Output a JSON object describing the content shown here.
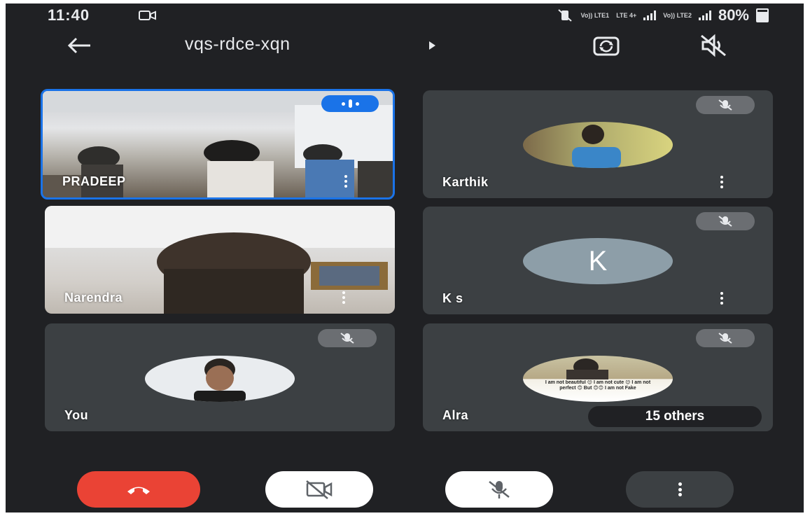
{
  "status_bar": {
    "time": "11:40",
    "net1": "Vo)) LTE1",
    "net2": "LTE 4+",
    "net3": "Vo)) LTE2",
    "battery": "80%"
  },
  "toolbar": {
    "meeting_code": "vqs-rdce-xqn"
  },
  "participants": [
    {
      "name": "PRADEEP",
      "state": "speaking"
    },
    {
      "name": "Karthik",
      "muted": true
    },
    {
      "name": "Narendra"
    },
    {
      "name": "K s",
      "initial": "K",
      "muted": true
    },
    {
      "name": "You",
      "muted": true
    },
    {
      "name": "Alra",
      "muted": true,
      "status_text": "I am not beautiful 😊 I am not cute 😊 I am not perfect 😊 But 😊😊 I am not Fake"
    }
  ],
  "others_label": "15 others",
  "colors": {
    "background": "#202124",
    "tile": "#3c4043",
    "active_speaker": "#1a73e8",
    "end_call": "#ea4335"
  },
  "controls": [
    "end-call",
    "camera-off",
    "mic-off",
    "more-options"
  ]
}
